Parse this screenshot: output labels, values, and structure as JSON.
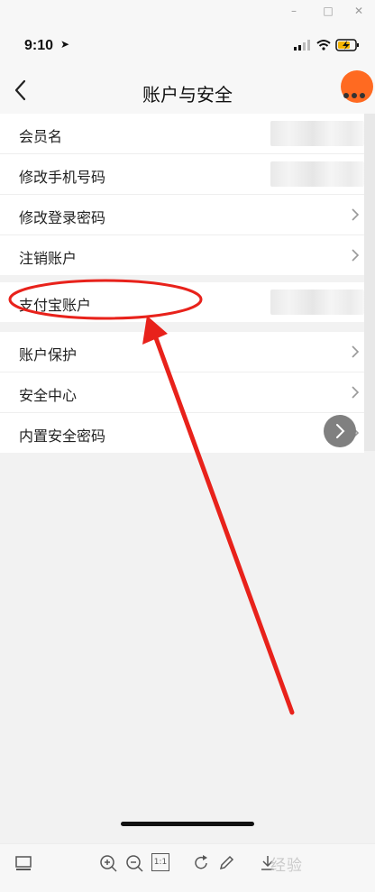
{
  "window": {
    "minimize_glyph": "–",
    "maximize_glyph": "□",
    "close_glyph": "✕"
  },
  "status_bar": {
    "time": "9:10",
    "location_icon": "location-arrow-icon",
    "signal_icon": "cellular-signal-icon",
    "wifi_icon": "wifi-icon",
    "battery_icon": "battery-charging-icon"
  },
  "nav": {
    "title": "账户与安全",
    "back_icon": "chevron-left-icon",
    "more_icon": "more-dots-icon",
    "accent_color": "#ff6a21"
  },
  "groups": [
    {
      "rows": [
        {
          "label": "会员名",
          "value_redacted": true,
          "chevron": false
        },
        {
          "label": "修改手机号码",
          "value_redacted": true,
          "chevron": false
        },
        {
          "label": "修改登录密码",
          "value_redacted": false,
          "chevron": true
        },
        {
          "label": "注销账户",
          "value_redacted": false,
          "chevron": true
        }
      ]
    },
    {
      "rows": [
        {
          "label": "支付宝账户",
          "value_redacted": true,
          "chevron": false
        }
      ]
    },
    {
      "rows": [
        {
          "label": "账户保护",
          "value_redacted": false,
          "chevron": true
        },
        {
          "label": "安全中心",
          "value_redacted": false,
          "chevron": true
        },
        {
          "label": "内置安全密码",
          "value_redacted": false,
          "chevron": true
        }
      ]
    }
  ],
  "annotation": {
    "color": "#e8221b",
    "shape": "ellipse-with-arrow",
    "target": "支付宝账户"
  },
  "bottom_toolbar": {
    "icons": [
      "panel-icon",
      "zoom-in-icon",
      "zoom-out-icon",
      "actual-size-icon",
      "rotate-icon",
      "edit-pencil-icon",
      "download-icon"
    ],
    "actual_size_label": "1:1",
    "watermark": "经验"
  }
}
